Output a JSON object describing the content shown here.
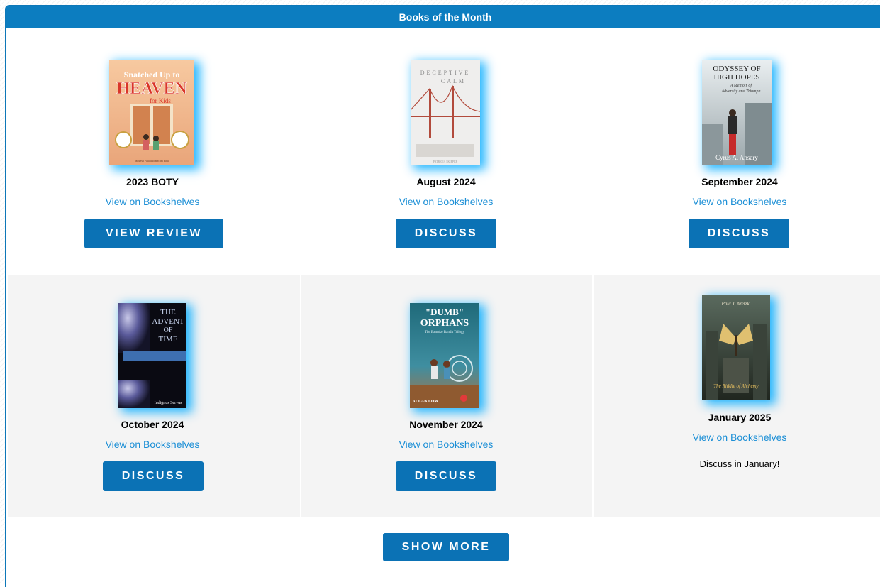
{
  "header": {
    "title": "Books of the Month"
  },
  "books": [
    {
      "title": "2023 BOTY",
      "link": "View on Bookshelves",
      "action": "VIEW REVIEW",
      "cover": {
        "line1": "Snatched Up to",
        "line2": "HEAVEN",
        "line3": "for Kids",
        "badge": "2021 BOOK OF THE YEAR",
        "author": "Jamiesa Paul and Rachel Paul"
      }
    },
    {
      "title": "August 2024",
      "link": "View on Bookshelves",
      "action": "DISCUSS",
      "cover": {
        "line1": "DECEPTIVE",
        "line2": "CALM",
        "author": "PATRICIA SKIPPER"
      }
    },
    {
      "title": "September 2024",
      "link": "View on Bookshelves",
      "action": "DISCUSS",
      "cover": {
        "line1": "ODYSSEY OF",
        "line2": "HIGH HOPES",
        "line3": "A Memoir of",
        "line4": "Adversity and Triumph",
        "author": "Cyrus A. Ansary"
      }
    },
    {
      "title": "October 2024",
      "link": "View on Bookshelves",
      "action": "DISCUSS",
      "cover": {
        "line1": "THE",
        "line2": "ADVENT",
        "line3": "OF",
        "line4": "TIME",
        "author": "Indignus Servus"
      }
    },
    {
      "title": "November 2024",
      "link": "View on Bookshelves",
      "action": "DISCUSS",
      "cover": {
        "line1": "\"DUMB\"",
        "line2": "ORPHANS",
        "line3": "The Bamako Bandit Trilogy",
        "author": "ALLAN LOW"
      }
    },
    {
      "title": "January 2025",
      "link": "View on Bookshelves",
      "note": "Discuss in January!",
      "cover": {
        "line1": "Paul J. Aretzki",
        "line2": "The Riddle of Alchemy"
      }
    }
  ],
  "footer": {
    "show_more": "SHOW MORE"
  },
  "colors": {
    "header": "#0c7dc0",
    "button": "#0b72b5",
    "link": "#1c8fd6",
    "glow": "#00aaff"
  }
}
